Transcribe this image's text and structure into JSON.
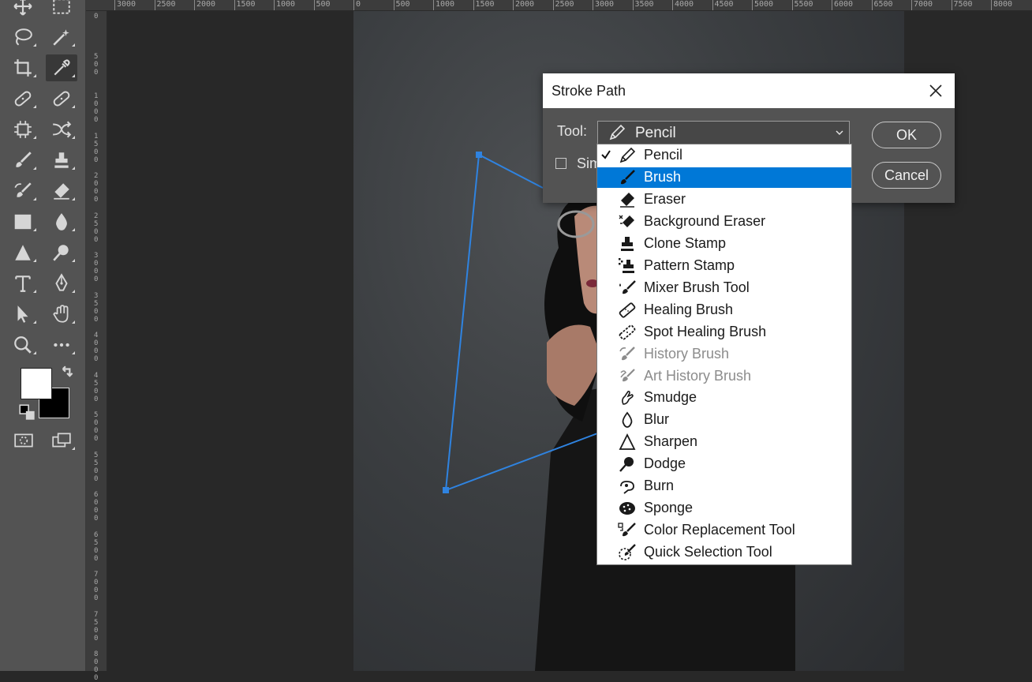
{
  "rulers": {
    "horizontal_ticks": [
      "3000",
      "2500",
      "2000",
      "1500",
      "1000",
      "500",
      "0",
      "500",
      "1000",
      "1500",
      "2000",
      "2500",
      "3000",
      "3500",
      "4000",
      "4500",
      "5000",
      "5500",
      "6000",
      "6500",
      "7000",
      "7500",
      "8000"
    ],
    "vertical_ticks": [
      "0",
      "500",
      "1000",
      "1500",
      "2000",
      "2500",
      "3000",
      "3500",
      "4000",
      "4500",
      "5000",
      "5500",
      "6000",
      "6500",
      "7000",
      "7500",
      "8000"
    ]
  },
  "toolbar": {
    "tools": [
      {
        "name": "move-tool",
        "icon": "move-icon"
      },
      {
        "name": "marquee-tool",
        "icon": "marquee-icon"
      },
      {
        "name": "lasso-tool",
        "icon": "lasso-icon"
      },
      {
        "name": "magic-wand-tool",
        "icon": "magic-wand-icon"
      },
      {
        "name": "crop-tool",
        "icon": "crop-icon"
      },
      {
        "name": "eyedropper-tool",
        "icon": "eyedropper-icon",
        "active": true
      },
      {
        "name": "healing-brush-tool",
        "icon": "bandage-icon"
      },
      {
        "name": "patch-tool",
        "icon": "bandage-icon"
      },
      {
        "name": "content-aware-tool",
        "icon": "chip-icon"
      },
      {
        "name": "content-move-tool",
        "icon": "shuffle-icon"
      },
      {
        "name": "brush-tool",
        "icon": "brush-icon"
      },
      {
        "name": "stamp-tool",
        "icon": "stamp-icon"
      },
      {
        "name": "history-brush-tool",
        "icon": "history-brush-icon"
      },
      {
        "name": "eraser-tool",
        "icon": "eraser-icon"
      },
      {
        "name": "gradient-tool",
        "icon": "gradient-icon"
      },
      {
        "name": "blur-tool",
        "icon": "drop-icon"
      },
      {
        "name": "sharpen-tool",
        "icon": "triangle-icon"
      },
      {
        "name": "dodge-tool",
        "icon": "dodge-icon"
      },
      {
        "name": "type-tool",
        "icon": "type-icon"
      },
      {
        "name": "pen-tool",
        "icon": "pen-icon"
      },
      {
        "name": "path-selection-tool",
        "icon": "arrow-icon"
      },
      {
        "name": "hand-tool",
        "icon": "hand-icon"
      },
      {
        "name": "zoom-tool",
        "icon": "zoom-icon"
      },
      {
        "name": "more-tools",
        "icon": "ellipsis-icon"
      }
    ],
    "foreground_color": "#ffffff",
    "background_color": "#000000"
  },
  "dialog": {
    "title": "Stroke Path",
    "tool_label": "Tool:",
    "selected_tool": "Pencil",
    "simulate_label_visible": "Sim",
    "ok_label": "OK",
    "cancel_label": "Cancel"
  },
  "dropdown": {
    "checked_index": 0,
    "highlight_index": 1,
    "items": [
      {
        "label": "Pencil",
        "icon": "pencil-icon",
        "disabled": false
      },
      {
        "label": "Brush",
        "icon": "brush-icon",
        "disabled": false
      },
      {
        "label": "Eraser",
        "icon": "eraser-icon",
        "disabled": false
      },
      {
        "label": "Background Eraser",
        "icon": "background-eraser-icon",
        "disabled": false
      },
      {
        "label": "Clone Stamp",
        "icon": "clone-stamp-icon",
        "disabled": false
      },
      {
        "label": "Pattern Stamp",
        "icon": "pattern-stamp-icon",
        "disabled": false
      },
      {
        "label": "Mixer Brush Tool",
        "icon": "mixer-brush-icon",
        "disabled": false
      },
      {
        "label": "Healing Brush",
        "icon": "healing-brush-icon",
        "disabled": false
      },
      {
        "label": "Spot Healing Brush",
        "icon": "spot-healing-brush-icon",
        "disabled": false
      },
      {
        "label": "History Brush",
        "icon": "history-brush-icon",
        "disabled": true
      },
      {
        "label": "Art History Brush",
        "icon": "art-history-brush-icon",
        "disabled": true
      },
      {
        "label": "Smudge",
        "icon": "smudge-icon",
        "disabled": false
      },
      {
        "label": "Blur",
        "icon": "blur-icon",
        "disabled": false
      },
      {
        "label": "Sharpen",
        "icon": "sharpen-icon",
        "disabled": false
      },
      {
        "label": "Dodge",
        "icon": "dodge-icon",
        "disabled": false
      },
      {
        "label": "Burn",
        "icon": "burn-icon",
        "disabled": false
      },
      {
        "label": "Sponge",
        "icon": "sponge-icon",
        "disabled": false
      },
      {
        "label": "Color Replacement Tool",
        "icon": "color-replacement-icon",
        "disabled": false
      },
      {
        "label": "Quick Selection Tool",
        "icon": "quick-selection-icon",
        "disabled": false
      }
    ]
  },
  "colors": {
    "path_stroke": "#2f83e0",
    "selection_highlight": "#0078d7"
  }
}
